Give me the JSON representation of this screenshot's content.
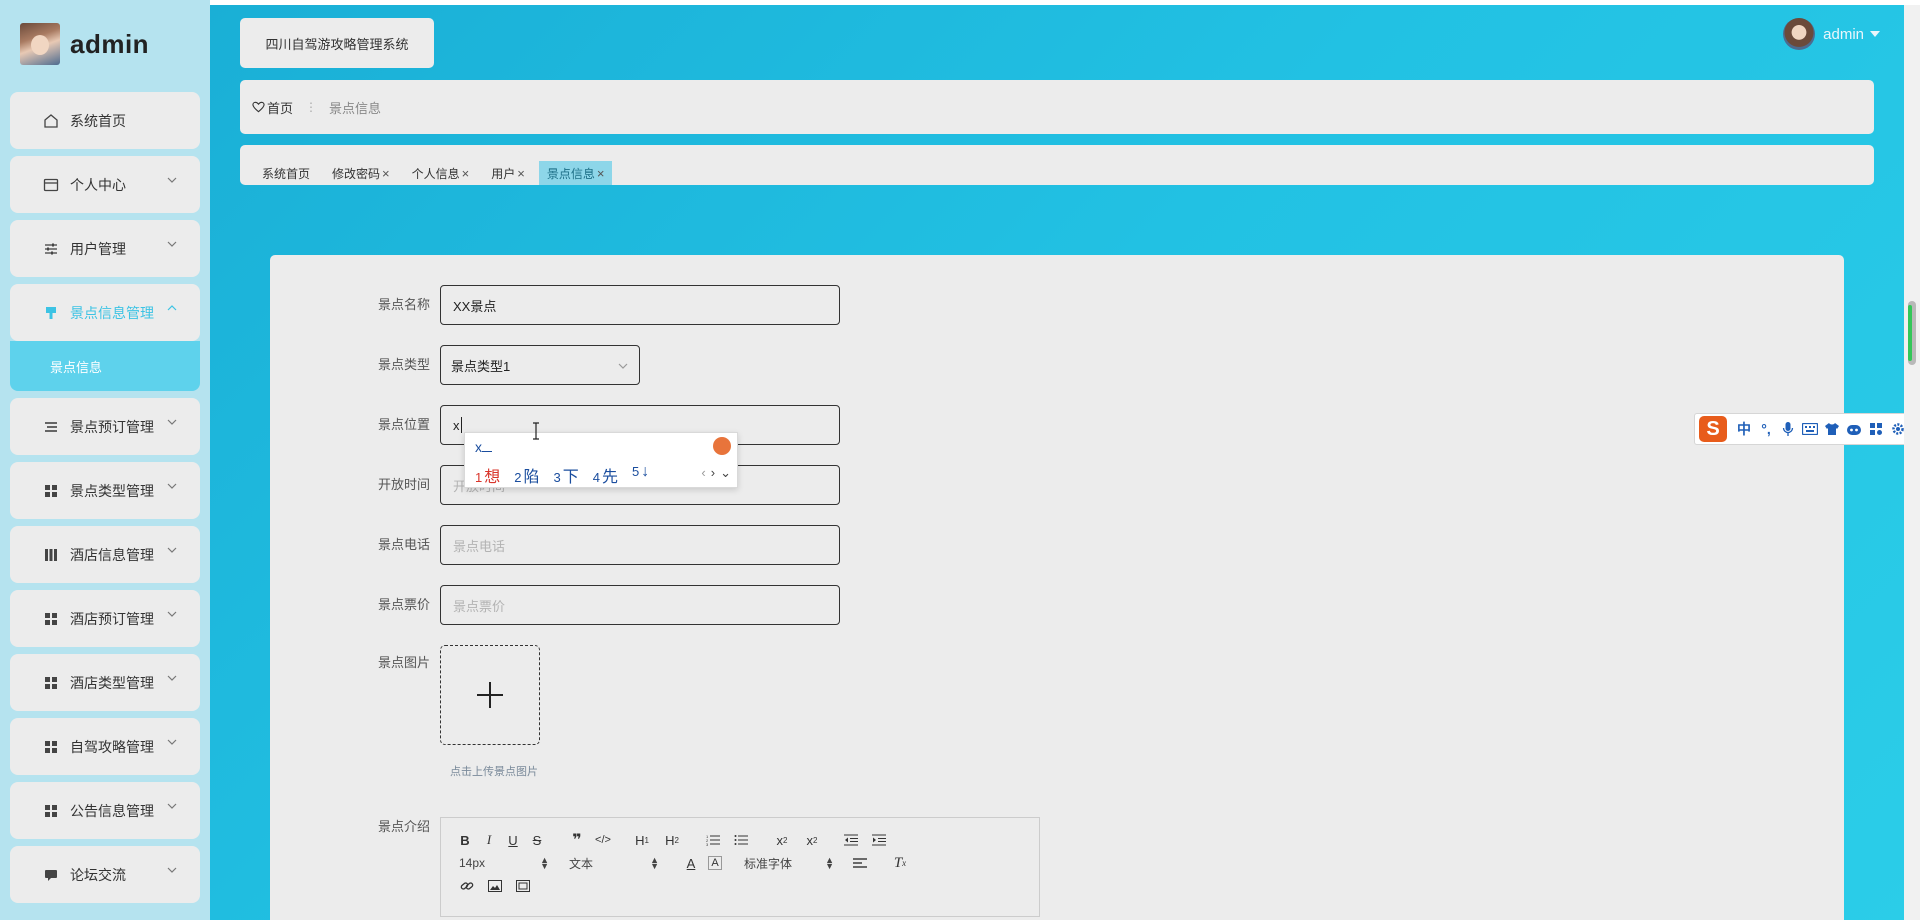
{
  "brand": {
    "name": "admin"
  },
  "sidebar": {
    "items": [
      {
        "label": "系统首页",
        "icon": "home-icon",
        "has_children": false
      },
      {
        "label": "个人中心",
        "icon": "card-icon",
        "has_children": true
      },
      {
        "label": "用户管理",
        "icon": "sliders-icon",
        "has_children": true
      },
      {
        "label": "景点信息管理",
        "icon": "brush-icon",
        "has_children": true,
        "expanded": true,
        "active": true
      },
      {
        "label": "景点预订管理",
        "icon": "list-icon",
        "has_children": true
      },
      {
        "label": "景点类型管理",
        "icon": "grid-icon",
        "has_children": true
      },
      {
        "label": "酒店信息管理",
        "icon": "building-icon",
        "has_children": true
      },
      {
        "label": "酒店预订管理",
        "icon": "grid-icon",
        "has_children": true
      },
      {
        "label": "酒店类型管理",
        "icon": "grid-icon",
        "has_children": true
      },
      {
        "label": "自驾攻略管理",
        "icon": "grid-icon",
        "has_children": true
      },
      {
        "label": "公告信息管理",
        "icon": "grid-icon",
        "has_children": true
      },
      {
        "label": "论坛交流",
        "icon": "chat-icon",
        "has_children": true
      }
    ],
    "submenu_active": "景点信息",
    "accent": "#3cc3e4"
  },
  "header": {
    "system_title": "四川自驾游攻略管理系统",
    "user": "admin"
  },
  "breadcrumb": {
    "home": "首页",
    "current": "景点信息"
  },
  "tabs": [
    {
      "label": "系统首页",
      "closable": false
    },
    {
      "label": "修改密码",
      "closable": true
    },
    {
      "label": "个人信息",
      "closable": true
    },
    {
      "label": "用户",
      "closable": true
    },
    {
      "label": "景点信息",
      "closable": true,
      "active": true
    }
  ],
  "form": {
    "name": {
      "label": "景点名称",
      "value": "XX景点"
    },
    "type": {
      "label": "景点类型",
      "value": "景点类型1"
    },
    "location": {
      "label": "景点位置",
      "value": "x"
    },
    "open_time": {
      "label": "开放时间",
      "placeholder": "开放时间"
    },
    "phone": {
      "label": "景点电话",
      "placeholder": "景点电话"
    },
    "price": {
      "label": "景点票价",
      "placeholder": "景点票价"
    },
    "image": {
      "label": "景点图片",
      "tip": "点击上传景点图片"
    },
    "intro": {
      "label": "景点介绍",
      "toolbar": {
        "font_size": "14px",
        "header_select": "文本",
        "font_family": "标准字体"
      }
    }
  },
  "ime": {
    "composition": "x",
    "candidates": [
      {
        "n": "1",
        "text": "想"
      },
      {
        "n": "2",
        "text": "陷"
      },
      {
        "n": "3",
        "text": "下"
      },
      {
        "n": "4",
        "text": "先"
      },
      {
        "n": "5",
        "text": "↓"
      }
    ],
    "bar_logo": "S",
    "bar_mode": "中"
  }
}
